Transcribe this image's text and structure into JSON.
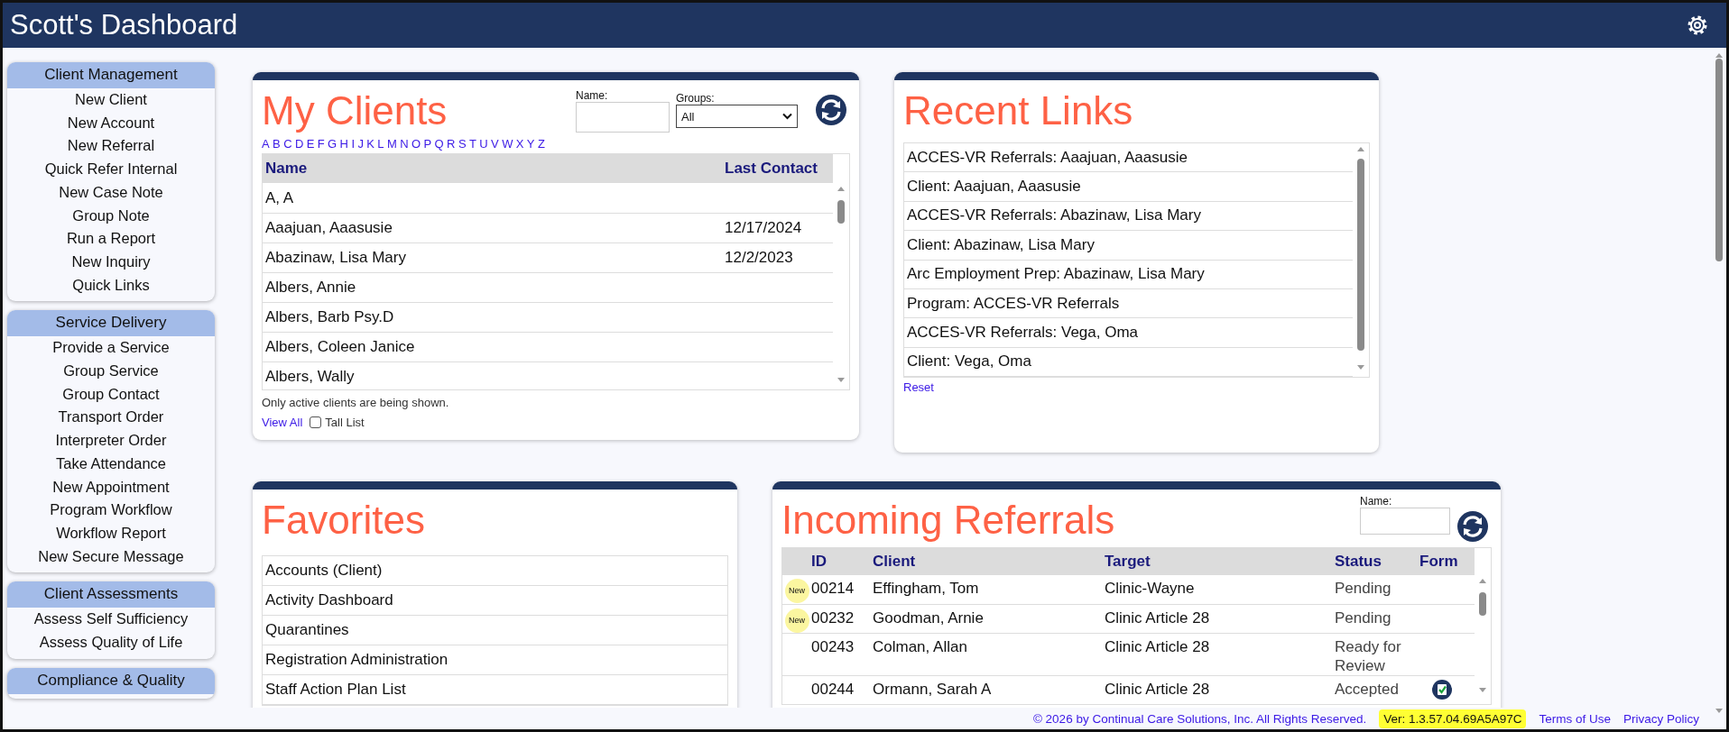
{
  "header": {
    "title": "Scott's Dashboard"
  },
  "sidebar": {
    "sections": [
      {
        "title": "Client Management",
        "items": [
          "New Client",
          "New Account",
          "New Referral",
          "Quick Refer Internal",
          "New Case Note",
          "Group Note",
          "Run a Report",
          "New Inquiry",
          "Quick Links"
        ]
      },
      {
        "title": "Service Delivery",
        "items": [
          "Provide a Service",
          "Group Service",
          "Group Contact",
          "Transport Order",
          "Interpreter Order",
          "Take Attendance",
          "New Appointment",
          "Program Workflow",
          "Workflow Report",
          "New Secure Message"
        ]
      },
      {
        "title": "Client Assessments",
        "items": [
          "Assess Self Sufficiency",
          "Assess Quality of Life"
        ]
      },
      {
        "title": "Compliance & Quality"
      }
    ]
  },
  "my_clients": {
    "title": "My Clients",
    "name_filter": {
      "label": "Name:"
    },
    "groups_filter": {
      "label": "Groups:",
      "value": "All"
    },
    "letters": [
      "A",
      "B",
      "C",
      "D",
      "E",
      "F",
      "G",
      "H",
      "I",
      "J",
      "K",
      "L",
      "M",
      "N",
      "O",
      "P",
      "Q",
      "R",
      "S",
      "T",
      "U",
      "V",
      "W",
      "X",
      "Y",
      "Z"
    ],
    "columns": [
      "Name",
      "Last Contact"
    ],
    "rows": [
      {
        "name": "A, A"
      },
      {
        "name": "Aaajuan, Aaasusie",
        "last_contact": "12/17/2024"
      },
      {
        "name": "Abazinaw, Lisa Mary",
        "last_contact": "12/2/2023"
      },
      {
        "name": "Albers, Annie"
      },
      {
        "name": "Albers, Barb Psy.D"
      },
      {
        "name": "Albers, Coleen Janice"
      },
      {
        "name": "Albers, Wally"
      }
    ],
    "note": "Only active clients are being shown.",
    "view_all": "View All",
    "tall_list": {
      "label": "Tall List",
      "checked": false
    }
  },
  "recent_links": {
    "title": "Recent Links",
    "items": [
      "ACCES-VR Referrals: Aaajuan, Aaasusie",
      "Client: Aaajuan, Aaasusie",
      "ACCES-VR Referrals: Abazinaw, Lisa Mary",
      "Client: Abazinaw, Lisa Mary",
      "Arc Employment Prep: Abazinaw, Lisa Mary",
      "Program: ACCES-VR Referrals",
      "ACCES-VR Referrals: Vega, Oma",
      "Client: Vega, Oma"
    ],
    "reset": "Reset"
  },
  "favorites": {
    "title": "Favorites",
    "items": [
      "Accounts (Client)",
      "Activity Dashboard",
      "Quarantines",
      "Registration Administration",
      "Staff Action Plan List"
    ]
  },
  "incoming_referrals": {
    "title": "Incoming Referrals",
    "name_filter": {
      "label": "Name:"
    },
    "columns": [
      "ID",
      "Client",
      "Target",
      "Status",
      "Form"
    ],
    "rows": [
      {
        "badge": "New",
        "id": "00214",
        "client": "Effingham, Tom",
        "target": "Clinic-Wayne",
        "status": "Pending",
        "form": false
      },
      {
        "badge": "New",
        "id": "00232",
        "client": "Goodman, Arnie",
        "target": "Clinic Article 28",
        "status": "Pending",
        "form": false
      },
      {
        "id": "00243",
        "client": "Colman, Allan",
        "target": "Clinic Article 28",
        "status": "Ready for Review",
        "form": false
      },
      {
        "id": "00244",
        "client": "Ormann, Sarah A",
        "target": "Clinic Article 28",
        "status": "Accepted",
        "form": true
      }
    ]
  },
  "footer": {
    "copyright": "© 2026 by Continual Care Solutions, Inc. All Rights Reserved.",
    "version": "Ver: 1.3.57.04.69A5A97C",
    "links": [
      "Terms of Use",
      "Privacy Policy"
    ]
  }
}
